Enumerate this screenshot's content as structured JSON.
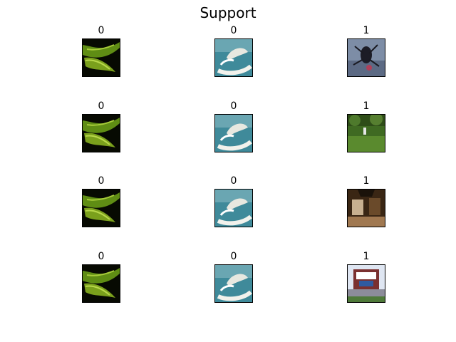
{
  "figure": {
    "title": "Support"
  },
  "grid": {
    "rows": [
      {
        "labels": [
          "0",
          "0",
          "1"
        ],
        "images": [
          "green-leaf-image",
          "white-coil-image",
          "insect-image"
        ]
      },
      {
        "labels": [
          "0",
          "0",
          "1"
        ],
        "images": [
          "green-leaf-image",
          "white-coil-image",
          "park-image"
        ]
      },
      {
        "labels": [
          "0",
          "0",
          "1"
        ],
        "images": [
          "green-leaf-image",
          "white-coil-image",
          "interior-image"
        ]
      },
      {
        "labels": [
          "0",
          "0",
          "1"
        ],
        "images": [
          "green-leaf-image",
          "white-coil-image",
          "stadium-image"
        ]
      }
    ]
  }
}
